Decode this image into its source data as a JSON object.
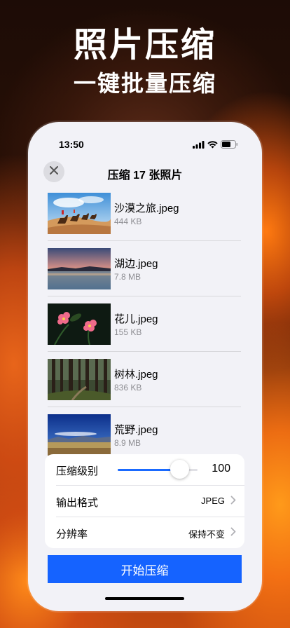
{
  "promo": {
    "headline": "照片压缩",
    "subline": "一键批量压缩"
  },
  "statusbar": {
    "time": "13:50",
    "icons": [
      "signal-icon",
      "wifi-icon",
      "battery-icon"
    ]
  },
  "nav": {
    "title": "压缩 17 张照片",
    "close_icon": "close-icon"
  },
  "files": [
    {
      "name": "沙漠之旅.jpeg",
      "size": "444 KB",
      "thumb": "desert-camels"
    },
    {
      "name": "湖边.jpeg",
      "size": "7.8 MB",
      "thumb": "lake-sunset"
    },
    {
      "name": "花儿.jpeg",
      "size": "155 KB",
      "thumb": "pink-flowers"
    },
    {
      "name": "树林.jpeg",
      "size": "836 KB",
      "thumb": "forest"
    },
    {
      "name": "荒野.jpeg",
      "size": "8.9 MB",
      "thumb": "wilderness"
    }
  ],
  "settings": {
    "level_label": "压缩级别",
    "level_value": "100",
    "level_fraction": 0.78,
    "format_label": "输出格式",
    "format_value": "JPEG",
    "resolution_label": "分辨率",
    "resolution_value": "保持不变"
  },
  "actions": {
    "start_label": "开始压缩"
  },
  "colors": {
    "accent": "#1563ff",
    "slider": "#1a6aff",
    "secondary_text": "#8e8e93"
  }
}
